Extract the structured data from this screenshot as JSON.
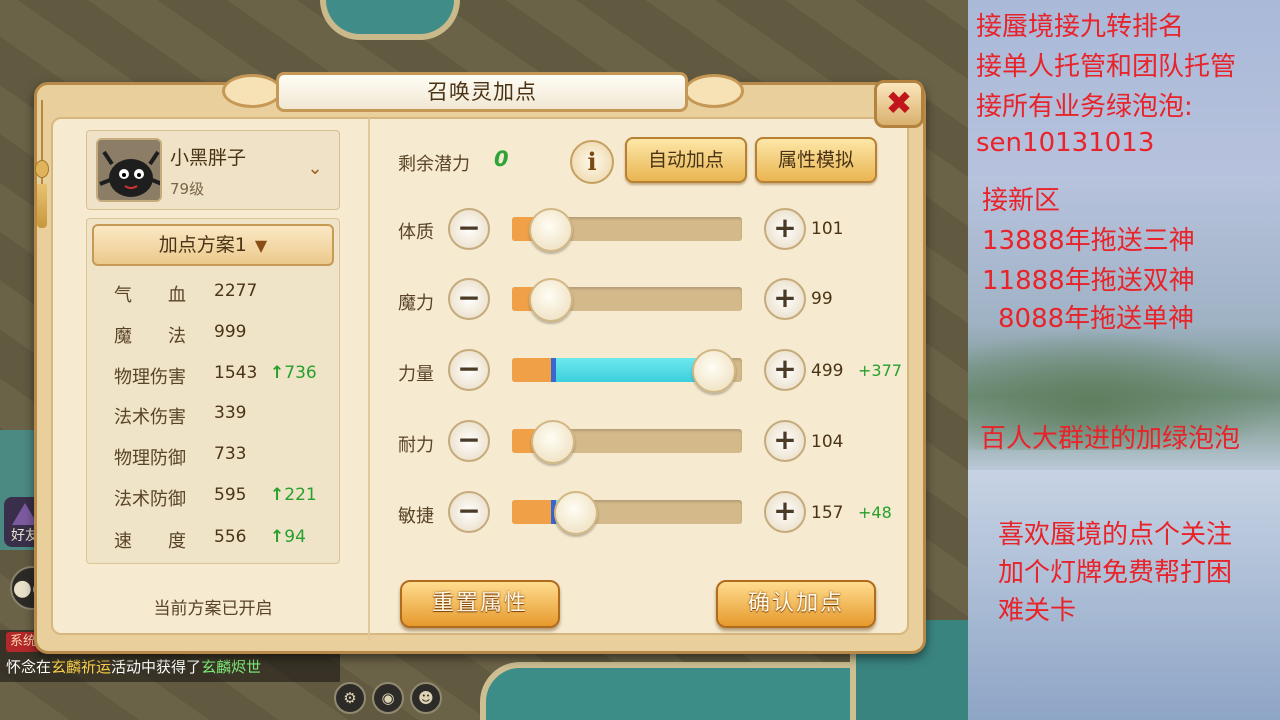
{
  "dialog": {
    "title": "召唤灵加点",
    "close_label": "✖"
  },
  "pet": {
    "name": "小黑胖子",
    "level": "79级",
    "expand_icon": "chevron-down-icon"
  },
  "plan": {
    "selected": "加点方案1",
    "status": "当前方案已开启"
  },
  "stats": [
    {
      "label": "气　　血",
      "value": "2277",
      "bonus": ""
    },
    {
      "label": "魔　　法",
      "value": "999",
      "bonus": ""
    },
    {
      "label": "物理伤害",
      "value": "1543",
      "bonus": "736"
    },
    {
      "label": "法术伤害",
      "value": "339",
      "bonus": ""
    },
    {
      "label": "物理防御",
      "value": "733",
      "bonus": ""
    },
    {
      "label": "法术防御",
      "value": "595",
      "bonus": "221"
    },
    {
      "label": "速　　度",
      "value": "556",
      "bonus": "94"
    }
  ],
  "potential": {
    "label": "剩余潜力",
    "value": "0"
  },
  "buttons": {
    "info": "i",
    "auto": "自动加点",
    "simulate": "属性模拟",
    "reset": "重置属性",
    "confirm": "确认加点"
  },
  "attributes": [
    {
      "label": "体质",
      "value": "101",
      "bonus": "",
      "base_fraction": 0.17,
      "added_fraction": 0
    },
    {
      "label": "魔力",
      "value": "99",
      "bonus": "",
      "base_fraction": 0.17,
      "added_fraction": 0
    },
    {
      "label": "力量",
      "value": "499",
      "bonus": "+377",
      "base_fraction": 0.17,
      "added_fraction": 0.71
    },
    {
      "label": "耐力",
      "value": "104",
      "bonus": "",
      "base_fraction": 0.18,
      "added_fraction": 0
    },
    {
      "label": "敏捷",
      "value": "157",
      "bonus": "+48",
      "base_fraction": 0.17,
      "added_fraction": 0.11
    }
  ],
  "chat": {
    "channel": "系统",
    "player": "怀念",
    "text_1": "在",
    "event": "玄麟祈运",
    "text_2": "活动中获得了",
    "item": "玄麟烬世"
  },
  "hud": {
    "friends_label": "好友"
  },
  "overlay": {
    "lines_top": [
      "接蜃境接九转排名",
      "接单人托管和团队托管",
      "接所有业务绿泡泡:",
      "sen10131013"
    ],
    "lines_mid": [
      "接新区",
      "13888年拖送三神",
      "11888年拖送双神",
      "8088年拖送单神"
    ],
    "line_group": "百人大群进的加绿泡泡",
    "lines_bottom": [
      "喜欢蜃境的点个关注",
      "加个灯牌免费帮打困",
      "难关卡"
    ]
  },
  "colors": {
    "accent_green": "#27a02c",
    "overlay_red": "#e8232a",
    "close_red": "#c0161b",
    "slider_cyan": "#3cd0dc"
  }
}
